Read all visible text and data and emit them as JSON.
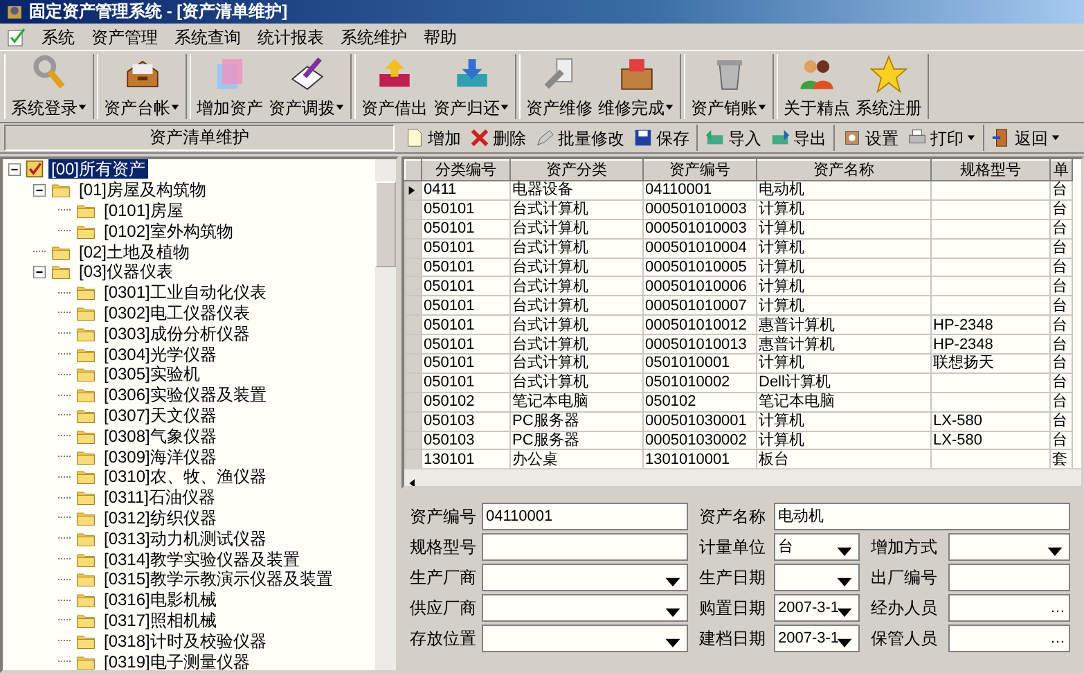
{
  "window": {
    "title": "固定资产管理系统 - [资产清单维护]"
  },
  "menu": [
    "系统",
    "资产管理",
    "系统查询",
    "统计报表",
    "系统维护",
    "帮助"
  ],
  "toolbar": [
    [
      {
        "label": "系统登录",
        "dropdown": true
      }
    ],
    [
      {
        "label": "资产台帐",
        "dropdown": true
      }
    ],
    [
      {
        "label": "增加资产",
        "dropdown": false
      },
      {
        "label": "资产调拨",
        "dropdown": true
      }
    ],
    [
      {
        "label": "资产借出",
        "dropdown": false
      },
      {
        "label": "资产归还",
        "dropdown": true
      }
    ],
    [
      {
        "label": "资产维修",
        "dropdown": false
      },
      {
        "label": "维修完成",
        "dropdown": true
      }
    ],
    [
      {
        "label": "资产销账",
        "dropdown": true
      }
    ],
    [
      {
        "label": "关于精点",
        "dropdown": false
      },
      {
        "label": "系统注册",
        "dropdown": false
      }
    ]
  ],
  "panel_title": "资产清单维护",
  "actions": [
    [
      {
        "label": "增加",
        "dropdown": false
      },
      {
        "label": "删除",
        "dropdown": false
      },
      {
        "label": "批量修改",
        "dropdown": false
      },
      {
        "label": "保存",
        "dropdown": false
      }
    ],
    [
      {
        "label": "导入",
        "dropdown": false
      },
      {
        "label": "导出",
        "dropdown": false
      }
    ],
    [
      {
        "label": "设置",
        "dropdown": false
      },
      {
        "label": "打印",
        "dropdown": true
      }
    ],
    [
      {
        "label": "返回",
        "dropdown": true
      }
    ]
  ],
  "tree": {
    "label": "[00]所有资产",
    "checked": true,
    "selected": true,
    "expanded": true,
    "children": [
      {
        "label": "[01]房屋及构筑物",
        "selected": false,
        "expanded": true,
        "children": [
          {
            "label": "[0101]房屋",
            "selected": false
          },
          {
            "label": "[0102]室外构筑物",
            "selected": false
          }
        ]
      },
      {
        "label": "[02]土地及植物",
        "selected": false
      },
      {
        "label": "[03]仪器仪表",
        "selected": false,
        "expanded": true,
        "children": [
          {
            "label": "[0301]工业自动化仪表",
            "selected": false
          },
          {
            "label": "[0302]电工仪器仪表",
            "selected": false
          },
          {
            "label": "[0303]成份分析仪器",
            "selected": false
          },
          {
            "label": "[0304]光学仪器",
            "selected": false
          },
          {
            "label": "[0305]实验机",
            "selected": false
          },
          {
            "label": "[0306]实验仪器及装置",
            "selected": false
          },
          {
            "label": "[0307]天文仪器",
            "selected": false
          },
          {
            "label": "[0308]气象仪器",
            "selected": false
          },
          {
            "label": "[0309]海洋仪器",
            "selected": false
          },
          {
            "label": "[0310]农、牧、渔仪器",
            "selected": false
          },
          {
            "label": "[0311]石油仪器",
            "selected": false
          },
          {
            "label": "[0312]纺织仪器",
            "selected": false
          },
          {
            "label": "[0313]动力机测试仪器",
            "selected": false
          },
          {
            "label": "[0314]教学实验仪器及装置",
            "selected": false
          },
          {
            "label": "[0315]教学示教演示仪器及装置",
            "selected": false
          },
          {
            "label": "[0316]电影机械",
            "selected": false
          },
          {
            "label": "[0317]照相机械",
            "selected": false
          },
          {
            "label": "[0318]计时及校验仪器",
            "selected": false
          },
          {
            "label": "[0319]电子测量仪器",
            "selected": false
          }
        ]
      }
    ]
  },
  "table": {
    "columns": [
      "分类编号",
      "资产分类",
      "资产编号",
      "资产名称",
      "规格型号",
      "单"
    ],
    "rows": [
      {
        "selected": true,
        "cells": [
          "0411",
          "电器设备",
          "04110001",
          "电动机",
          "",
          "台"
        ]
      },
      {
        "selected": false,
        "cells": [
          "050101",
          "台式计算机",
          "000501010003",
          "计算机",
          "",
          "台"
        ]
      },
      {
        "selected": false,
        "cells": [
          "050101",
          "台式计算机",
          "000501010003",
          "计算机",
          "",
          "台"
        ]
      },
      {
        "selected": false,
        "cells": [
          "050101",
          "台式计算机",
          "000501010004",
          "计算机",
          "",
          "台"
        ]
      },
      {
        "selected": false,
        "cells": [
          "050101",
          "台式计算机",
          "000501010005",
          "计算机",
          "",
          "台"
        ]
      },
      {
        "selected": false,
        "cells": [
          "050101",
          "台式计算机",
          "000501010006",
          "计算机",
          "",
          "台"
        ]
      },
      {
        "selected": false,
        "cells": [
          "050101",
          "台式计算机",
          "000501010007",
          "计算机",
          "",
          "台"
        ]
      },
      {
        "selected": false,
        "cells": [
          "050101",
          "台式计算机",
          "000501010012",
          "惠普计算机",
          "HP-2348",
          "台"
        ]
      },
      {
        "selected": false,
        "cells": [
          "050101",
          "台式计算机",
          "000501010013",
          "惠普计算机",
          "HP-2348",
          "台"
        ]
      },
      {
        "selected": false,
        "cells": [
          "050101",
          "台式计算机",
          "0501010001",
          "计算机",
          "联想扬天",
          "台"
        ]
      },
      {
        "selected": false,
        "cells": [
          "050101",
          "台式计算机",
          "0501010002",
          "Dell计算机",
          "",
          "台"
        ]
      },
      {
        "selected": false,
        "cells": [
          "050102",
          "笔记本电脑",
          "050102",
          "笔记本电脑",
          "",
          "台"
        ]
      },
      {
        "selected": false,
        "cells": [
          "050103",
          "PC服务器",
          "000501030001",
          "计算机",
          "LX-580",
          "台"
        ]
      },
      {
        "selected": false,
        "cells": [
          "050103",
          "PC服务器",
          "000501030002",
          "计算机",
          "LX-580",
          "台"
        ]
      },
      {
        "selected": false,
        "cells": [
          "130101",
          "办公桌",
          "1301010001",
          "板台",
          "",
          "套"
        ]
      }
    ]
  },
  "form": [
    [
      {
        "label": "资产编号",
        "kind": "text",
        "value": "04110001"
      },
      {
        "label": "资产名称",
        "kind": "text",
        "value": "电动机"
      }
    ],
    [
      {
        "label": "规格型号",
        "kind": "text"
      },
      {
        "label": "计量单位",
        "kind": "combo",
        "value": "台"
      },
      {
        "label": "增加方式",
        "kind": "combo"
      }
    ],
    [
      {
        "label": "生产厂商",
        "kind": "combo"
      },
      {
        "label": "生产日期",
        "kind": "combo"
      },
      {
        "label": "出厂编号",
        "kind": "text"
      }
    ],
    [
      {
        "label": "供应厂商",
        "kind": "combo"
      },
      {
        "label": "购置日期",
        "kind": "combo",
        "value": "2007-3-1"
      },
      {
        "label": "经办人员",
        "kind": "picker",
        "button": "…"
      }
    ],
    [
      {
        "label": "存放位置",
        "kind": "combo"
      },
      {
        "label": "建档日期",
        "kind": "combo",
        "value": "2007-3-1"
      },
      {
        "label": "保管人员",
        "kind": "picker",
        "button": "…"
      }
    ]
  ]
}
